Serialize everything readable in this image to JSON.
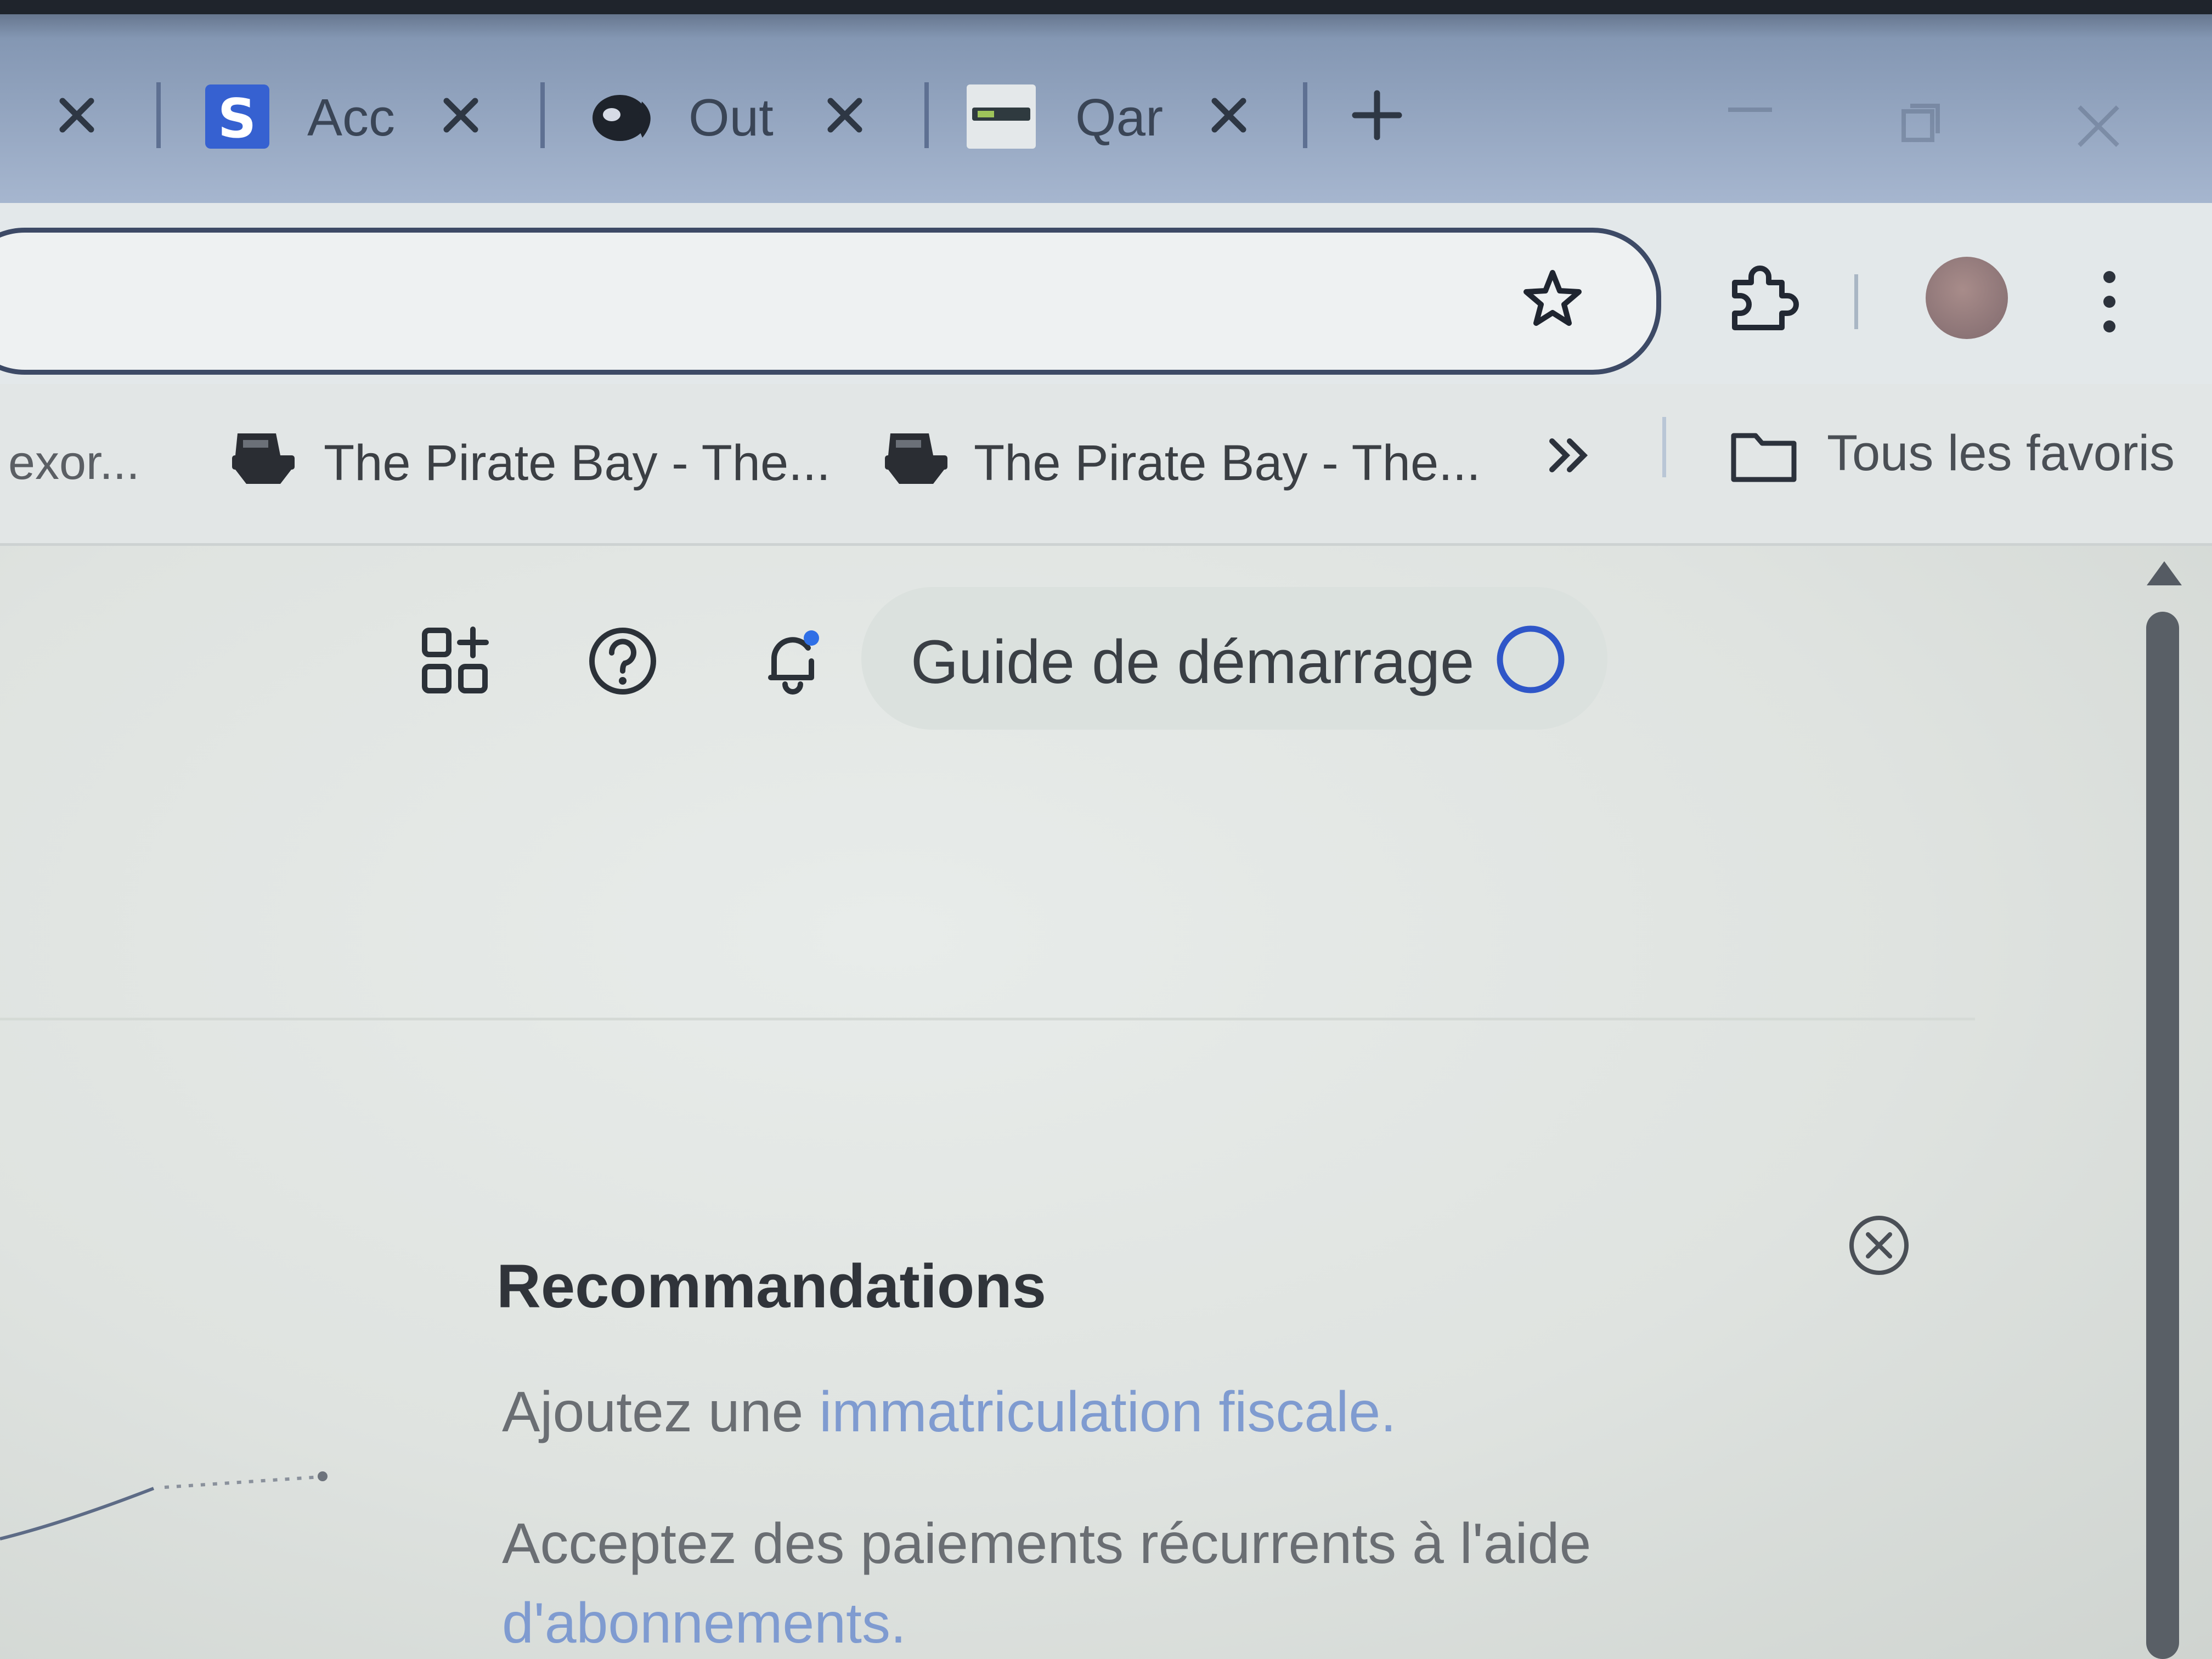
{
  "browser": {
    "tabs": [
      {
        "title": "Acc",
        "favicon": "s-logo-icon"
      },
      {
        "title": "Out",
        "favicon": "outline-logo-icon"
      },
      {
        "title": "Qar",
        "favicon": "ticket-icon"
      }
    ],
    "new_tab_icon": "plus-icon",
    "window_controls": [
      "minimize-icon",
      "restore-icon",
      "close-icon"
    ]
  },
  "toolbar": {
    "icons": [
      "star-icon",
      "extensions-icon",
      "avatar",
      "menu-icon"
    ]
  },
  "bookmarks": {
    "items": [
      {
        "label": "exor..."
      },
      {
        "label": "The Pirate Bay - The...",
        "icon": "pirate-ship-icon"
      },
      {
        "label": "The Pirate Bay - The...",
        "icon": "pirate-ship-icon"
      }
    ],
    "overflow_icon": "double-chevron-icon",
    "all_bookmarks": "Tous les favoris"
  },
  "app": {
    "toolbar_icons": [
      "add-widget-icon",
      "help-icon",
      "notifications-icon",
      "settings-icon",
      "create-icon"
    ],
    "guide_label": "Guide de démarrage",
    "accent": "#2f6fe6"
  },
  "recommendations": {
    "title": "Recommandations",
    "items": [
      {
        "prefix": "Ajoutez une ",
        "link": "immatriculation fiscale."
      },
      {
        "prefix": "Acceptez des paiements récurrents à l'aide",
        "link": "d'abonnements."
      }
    ]
  }
}
